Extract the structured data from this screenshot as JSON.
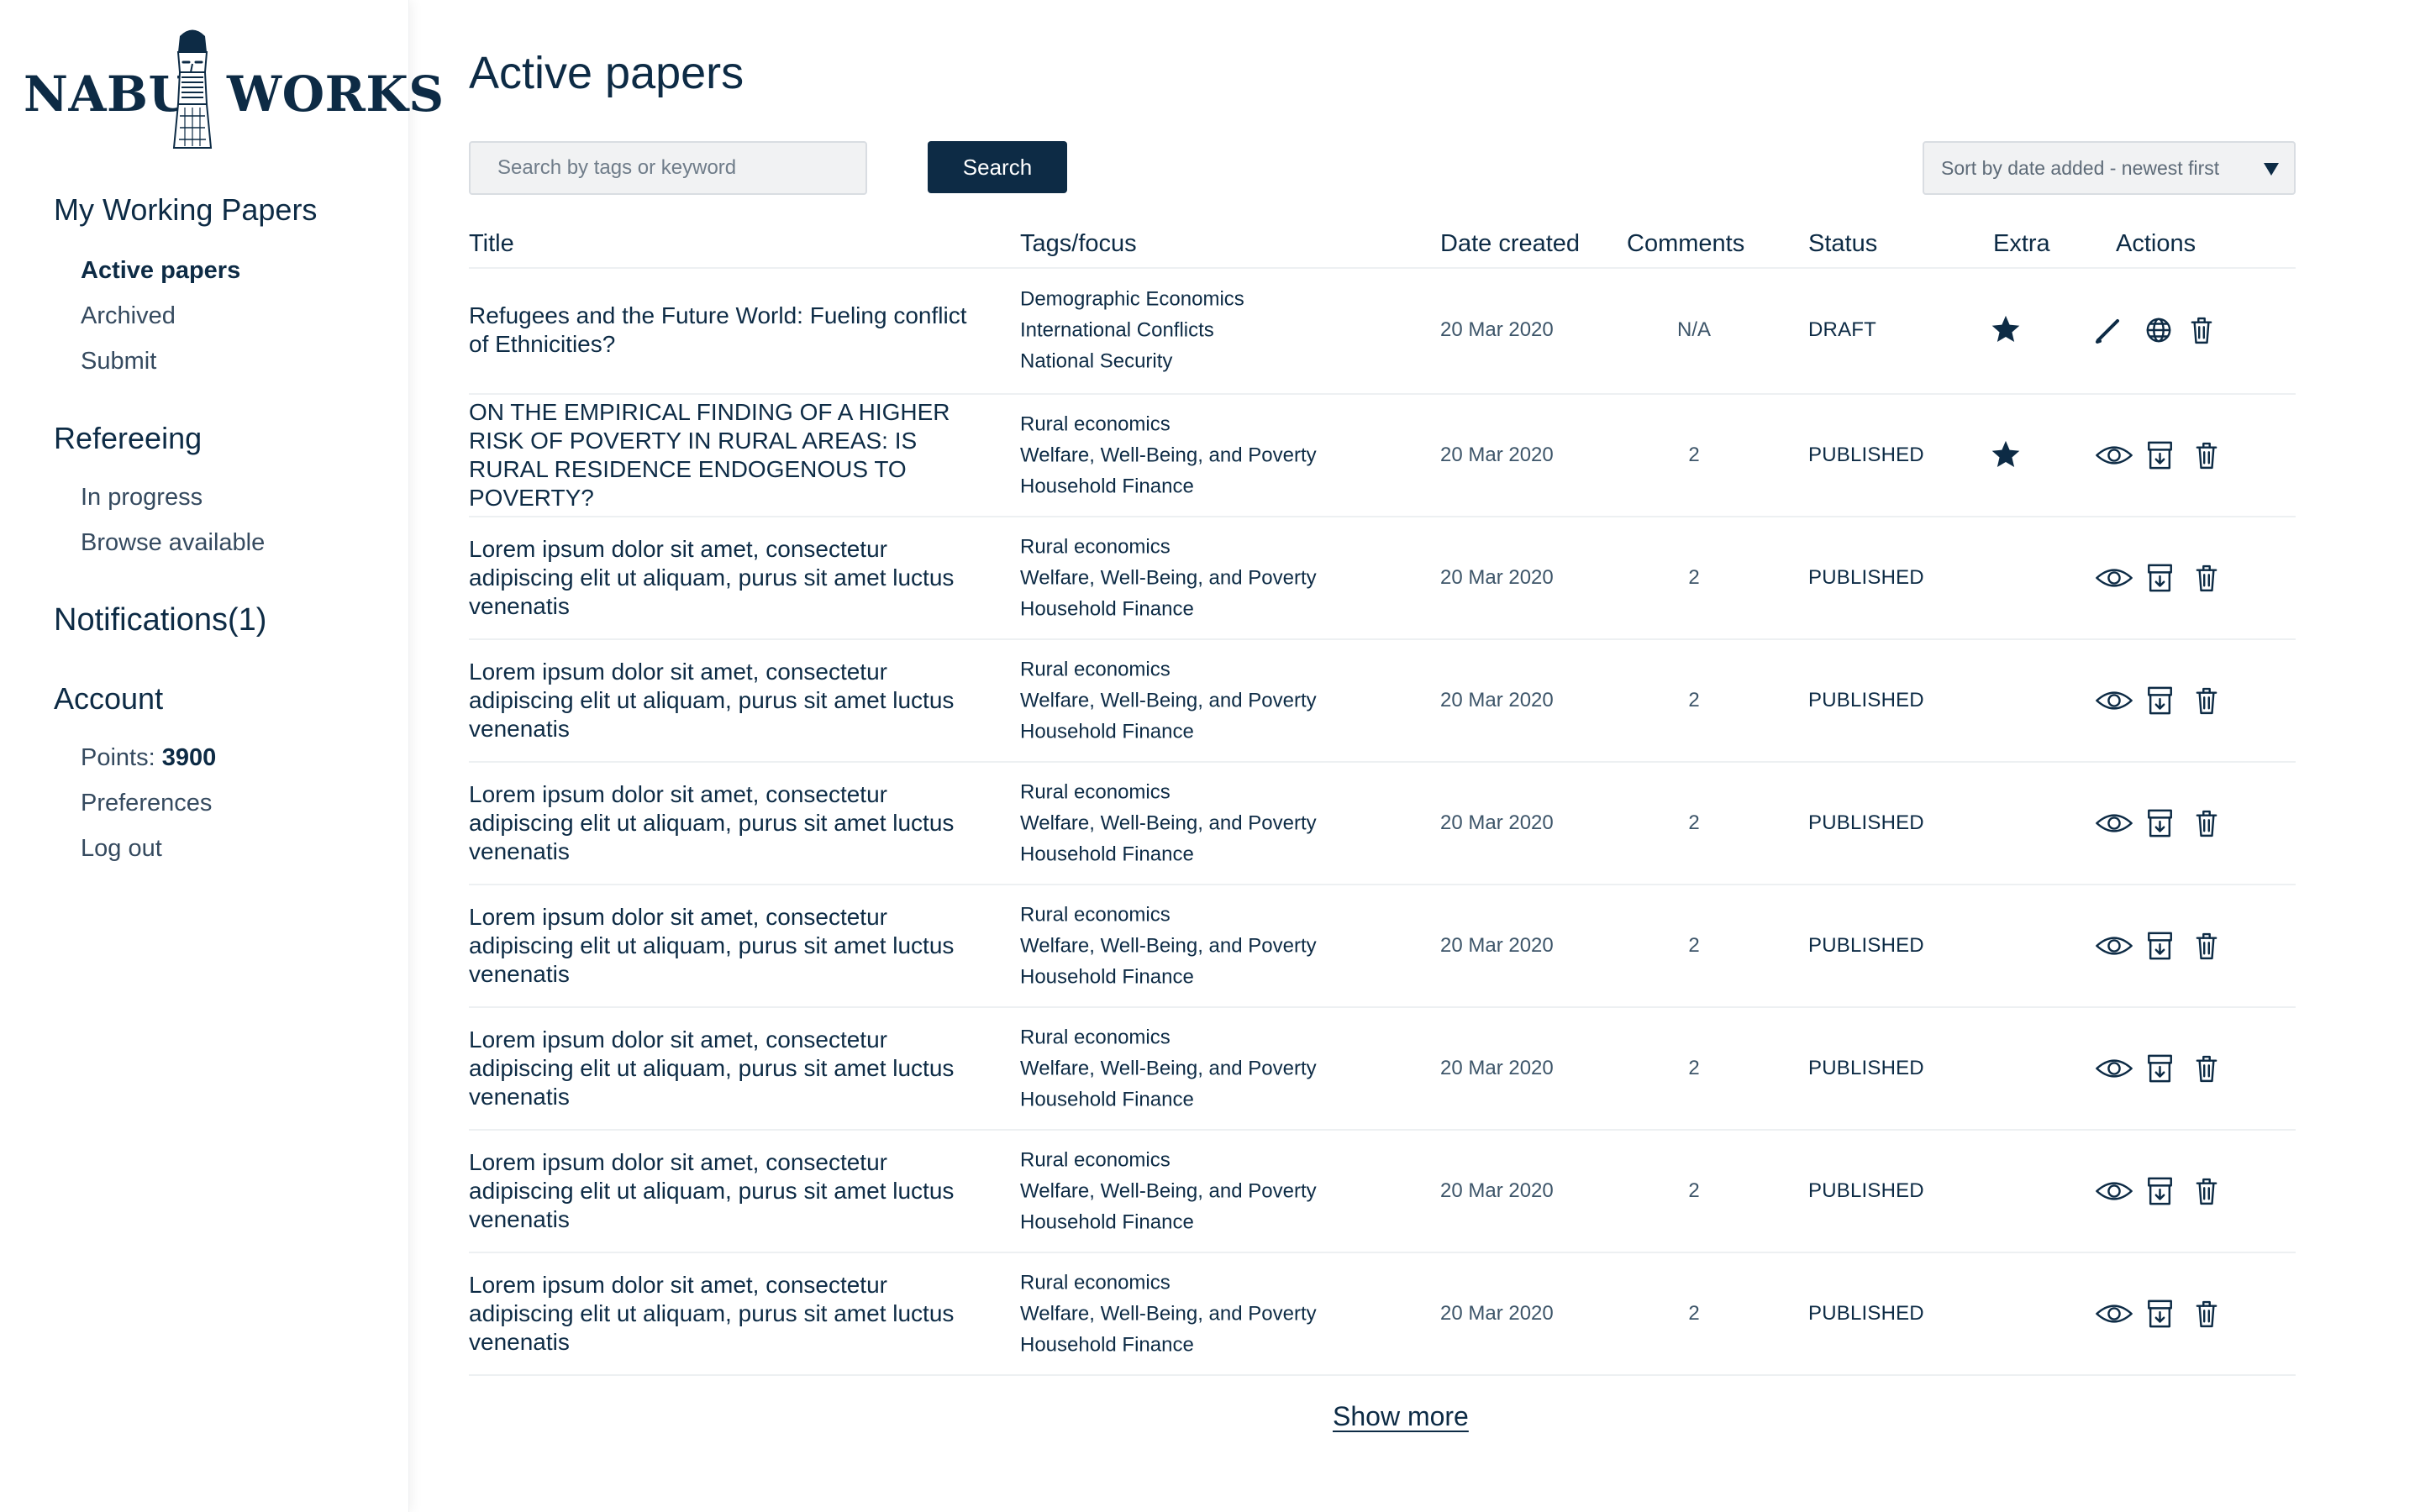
{
  "brand": {
    "left_word": "NABU",
    "right_word": "WORKS",
    "icon": "statue-head-icon"
  },
  "sidebar": {
    "sections": {
      "working": {
        "title": "My Working Papers",
        "items": [
          "Active papers",
          "Archived",
          "Submit"
        ],
        "active_item": "Active papers"
      },
      "refereeing": {
        "title": "Refereeing",
        "items": [
          "In progress",
          "Browse available"
        ]
      },
      "notifications": {
        "title": "Notifications(1)"
      },
      "account": {
        "title": "Account",
        "points_label": "Points: ",
        "points_value": "3900",
        "items": [
          "Preferences",
          "Log out"
        ]
      }
    }
  },
  "page": {
    "title": "Active papers"
  },
  "search": {
    "placeholder": "Search by tags or keyword",
    "value": "",
    "button_label": "Search"
  },
  "sort": {
    "selected": "Sort by date added - newest first",
    "icon": "chevron-down-icon"
  },
  "table": {
    "columns": [
      "Title",
      "Tags/focus",
      "Date created",
      "Comments",
      "Status",
      "Extra",
      "Actions"
    ],
    "rows": [
      {
        "title": "Refugees and the Future World: Fueling conflict of Ethnicities?",
        "tags": [
          "Demographic Economics",
          "International Conflicts",
          "National Security"
        ],
        "date": "20 Mar 2020",
        "comments": "N/A",
        "status": "DRAFT",
        "extra_starred": true,
        "actions": [
          "pencil-icon",
          "globe-icon",
          "trash-icon"
        ]
      },
      {
        "title": "ON THE EMPIRICAL FINDING OF A HIGHER RISK OF POVERTY IN RURAL AREAS: IS RURAL RESIDENCE ENDOGENOUS TO POVERTY?",
        "tags": [
          "Rural economics",
          "Welfare, Well-Being, and Poverty",
          "Household Finance"
        ],
        "date": "20 Mar 2020",
        "comments": "2",
        "status": "PUBLISHED",
        "extra_starred": true,
        "actions": [
          "eye-icon",
          "archive-icon",
          "trash-icon"
        ]
      },
      {
        "title": "Lorem ipsum dolor sit amet, consectetur adipiscing elit ut aliquam, purus sit amet luctus venenatis",
        "tags": [
          "Rural economics",
          "Welfare, Well-Being, and Poverty",
          "Household Finance"
        ],
        "date": "20 Mar 2020",
        "comments": "2",
        "status": "PUBLISHED",
        "extra_starred": false,
        "actions": [
          "eye-icon",
          "archive-icon",
          "trash-icon"
        ]
      },
      {
        "title": "Lorem ipsum dolor sit amet, consectetur adipiscing elit ut aliquam, purus sit amet luctus venenatis",
        "tags": [
          "Rural economics",
          "Welfare, Well-Being, and Poverty",
          "Household Finance"
        ],
        "date": "20 Mar 2020",
        "comments": "2",
        "status": "PUBLISHED",
        "extra_starred": false,
        "actions": [
          "eye-icon",
          "archive-icon",
          "trash-icon"
        ]
      },
      {
        "title": "Lorem ipsum dolor sit amet, consectetur adipiscing elit ut aliquam, purus sit amet luctus venenatis",
        "tags": [
          "Rural economics",
          "Welfare, Well-Being, and Poverty",
          "Household Finance"
        ],
        "date": "20 Mar 2020",
        "comments": "2",
        "status": "PUBLISHED",
        "extra_starred": false,
        "actions": [
          "eye-icon",
          "archive-icon",
          "trash-icon"
        ]
      },
      {
        "title": "Lorem ipsum dolor sit amet, consectetur adipiscing elit ut aliquam, purus sit amet luctus venenatis",
        "tags": [
          "Rural economics",
          "Welfare, Well-Being, and Poverty",
          "Household Finance"
        ],
        "date": "20 Mar 2020",
        "comments": "2",
        "status": "PUBLISHED",
        "extra_starred": false,
        "actions": [
          "eye-icon",
          "archive-icon",
          "trash-icon"
        ]
      },
      {
        "title": "Lorem ipsum dolor sit amet, consectetur adipiscing elit ut aliquam, purus sit amet luctus venenatis",
        "tags": [
          "Rural economics",
          "Welfare, Well-Being, and Poverty",
          "Household Finance"
        ],
        "date": "20 Mar 2020",
        "comments": "2",
        "status": "PUBLISHED",
        "extra_starred": false,
        "actions": [
          "eye-icon",
          "archive-icon",
          "trash-icon"
        ]
      },
      {
        "title": "Lorem ipsum dolor sit amet, consectetur adipiscing elit ut aliquam, purus sit amet luctus venenatis",
        "tags": [
          "Rural economics",
          "Welfare, Well-Being, and Poverty",
          "Household Finance"
        ],
        "date": "20 Mar 2020",
        "comments": "2",
        "status": "PUBLISHED",
        "extra_starred": false,
        "actions": [
          "eye-icon",
          "archive-icon",
          "trash-icon"
        ]
      },
      {
        "title": "Lorem ipsum dolor sit amet, consectetur adipiscing elit ut aliquam, purus sit amet luctus venenatis",
        "tags": [
          "Rural economics",
          "Welfare, Well-Being, and Poverty",
          "Household Finance"
        ],
        "date": "20 Mar 2020",
        "comments": "2",
        "status": "PUBLISHED",
        "extra_starred": false,
        "actions": [
          "eye-icon",
          "archive-icon",
          "trash-icon"
        ]
      }
    ]
  },
  "show_more_label": "Show more",
  "colors": {
    "primary": "#0d2b45",
    "muted_text": "#3d5569",
    "row_divider": "#edf0f2",
    "input_background": "#f1f2f3",
    "input_border": "#d9dde2"
  }
}
